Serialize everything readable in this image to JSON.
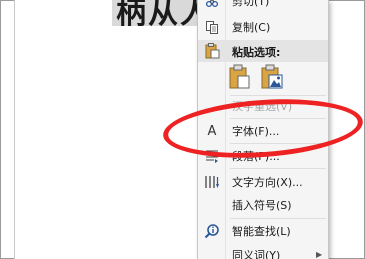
{
  "document": {
    "selected_text": "柄从人"
  },
  "context_menu": {
    "items": [
      {
        "label": "剪切(T)",
        "icon": "scissors-icon",
        "disabled": false
      },
      {
        "label": "复制(C)",
        "icon": "copy-icon",
        "disabled": false
      },
      {
        "label": "粘贴选项:",
        "icon": "paste-icon",
        "header": true
      },
      {
        "label": "汉字重选(V)",
        "icon": "",
        "disabled": true
      },
      {
        "label": "字体(F)...",
        "icon": "font-icon",
        "disabled": false
      },
      {
        "label": "段落(P)...",
        "icon": "paragraph-icon",
        "disabled": false
      },
      {
        "label": "文字方向(X)...",
        "icon": "text-direction-icon",
        "disabled": false
      },
      {
        "label": "插入符号(S)",
        "icon": "",
        "disabled": false
      },
      {
        "label": "智能查找(L)",
        "icon": "smart-lookup-icon",
        "disabled": false
      },
      {
        "label": "同义词(Y)",
        "icon": "",
        "disabled": false
      }
    ],
    "font_icon_glyph": "A"
  },
  "annotation": {
    "highlight_color": "#ee2222"
  },
  "colors": {
    "menu_bg": "#f5f5f5",
    "header_bg": "#e4e4e4",
    "disabled_text": "#a6a6a6"
  }
}
